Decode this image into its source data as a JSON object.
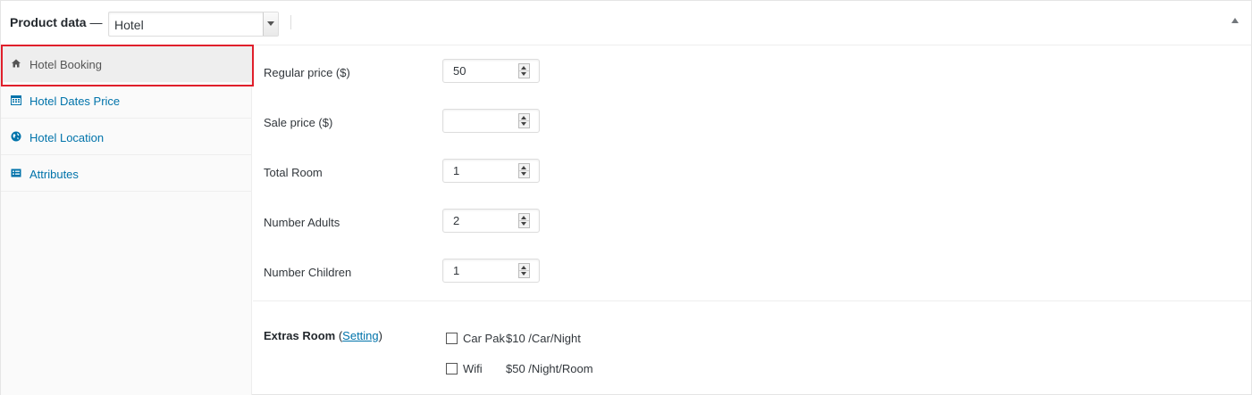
{
  "header": {
    "title": "Product data",
    "dash": "—",
    "product_type": "Hotel"
  },
  "sidebar": {
    "items": [
      {
        "label": "Hotel Booking",
        "icon": "home-icon",
        "active": true
      },
      {
        "label": "Hotel Dates Price",
        "icon": "calendar-icon",
        "active": false
      },
      {
        "label": "Hotel Location",
        "icon": "globe-icon",
        "active": false
      },
      {
        "label": "Attributes",
        "icon": "list-icon",
        "active": false
      }
    ]
  },
  "fields": [
    {
      "label": "Regular price ($)",
      "value": "50"
    },
    {
      "label": "Sale price ($)",
      "value": ""
    },
    {
      "label": "Total Room",
      "value": "1"
    },
    {
      "label": "Number Adults",
      "value": "2"
    },
    {
      "label": "Number Children",
      "value": "1"
    }
  ],
  "extras": {
    "label": "Extras Room",
    "open_paren": "(",
    "link": "Setting",
    "close_paren": ")",
    "items": [
      {
        "name": "Car Pak",
        "price": "$10 /Car/Night",
        "checked": false
      },
      {
        "name": "Wifi",
        "price": "$50 /Night/Room",
        "checked": false
      }
    ]
  },
  "colors": {
    "link": "#0073aa",
    "highlight": "#e01f2b",
    "icon": "#0073aa",
    "active_icon": "#555555"
  }
}
